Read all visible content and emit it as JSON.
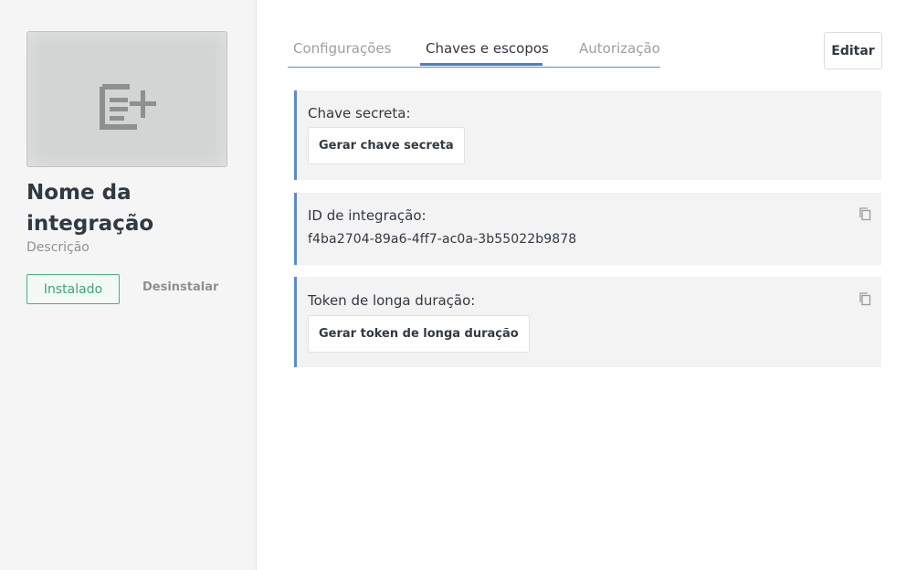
{
  "sidebar": {
    "thumbnail_icon": "post-add-icon",
    "integration_name": "Nome da integração",
    "description": "Descrição",
    "installed_label": "Instalado",
    "uninstall_label": "Desinstalar"
  },
  "tabs": [
    {
      "label": "Configurações",
      "active": false
    },
    {
      "label": "Chaves e escopos",
      "active": true
    },
    {
      "label": "Autorização",
      "active": false
    }
  ],
  "edit_label": "Editar",
  "cards": {
    "secret": {
      "label": "Chave secreta:",
      "button_label": "Gerar chave secreta"
    },
    "integration_id": {
      "label": "ID de integração:",
      "value": "f4ba2704-89a6-4ff7-ac0a-3b55022b9878",
      "copy_icon": "copy-icon"
    },
    "long_token": {
      "label": "Token de longa duração:",
      "button_label": "Gerar token de longa duração",
      "copy_icon": "copy-icon"
    }
  },
  "colors": {
    "accent": "#5a8dc8",
    "installed_green": "#3ea373",
    "sidebar_bg": "#f5f5f5",
    "card_bg": "#f3f3f3"
  }
}
